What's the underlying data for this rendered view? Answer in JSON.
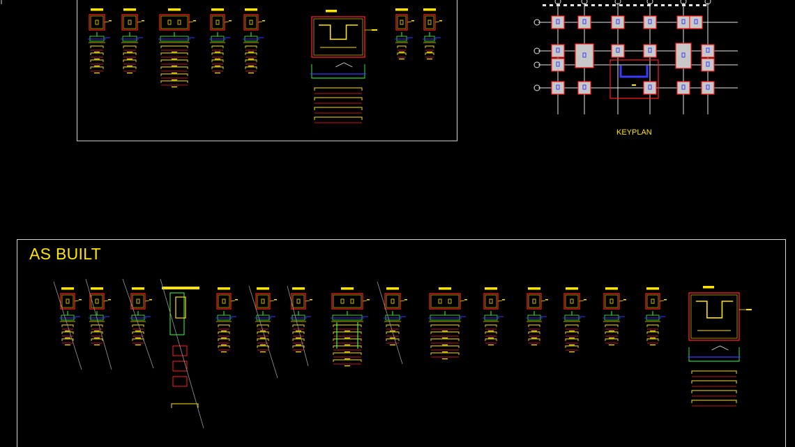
{
  "drawing": {
    "as_built_title": "AS BUILT",
    "keyplan_label": "KEYPLAN"
  },
  "colors": {
    "background": "#000000",
    "frame": "#d8d8d8",
    "text": "#ffe400",
    "outline": "#ff2020",
    "concrete": "#c8c8c8",
    "rebar": "#3a3aff",
    "dimension": "#ffe400",
    "detail": "#3cff3c",
    "grid": "#e6e6e6"
  },
  "sheets": [
    {
      "name": "details-sheet"
    },
    {
      "name": "as-built-sheet"
    },
    {
      "name": "keyplan"
    }
  ]
}
